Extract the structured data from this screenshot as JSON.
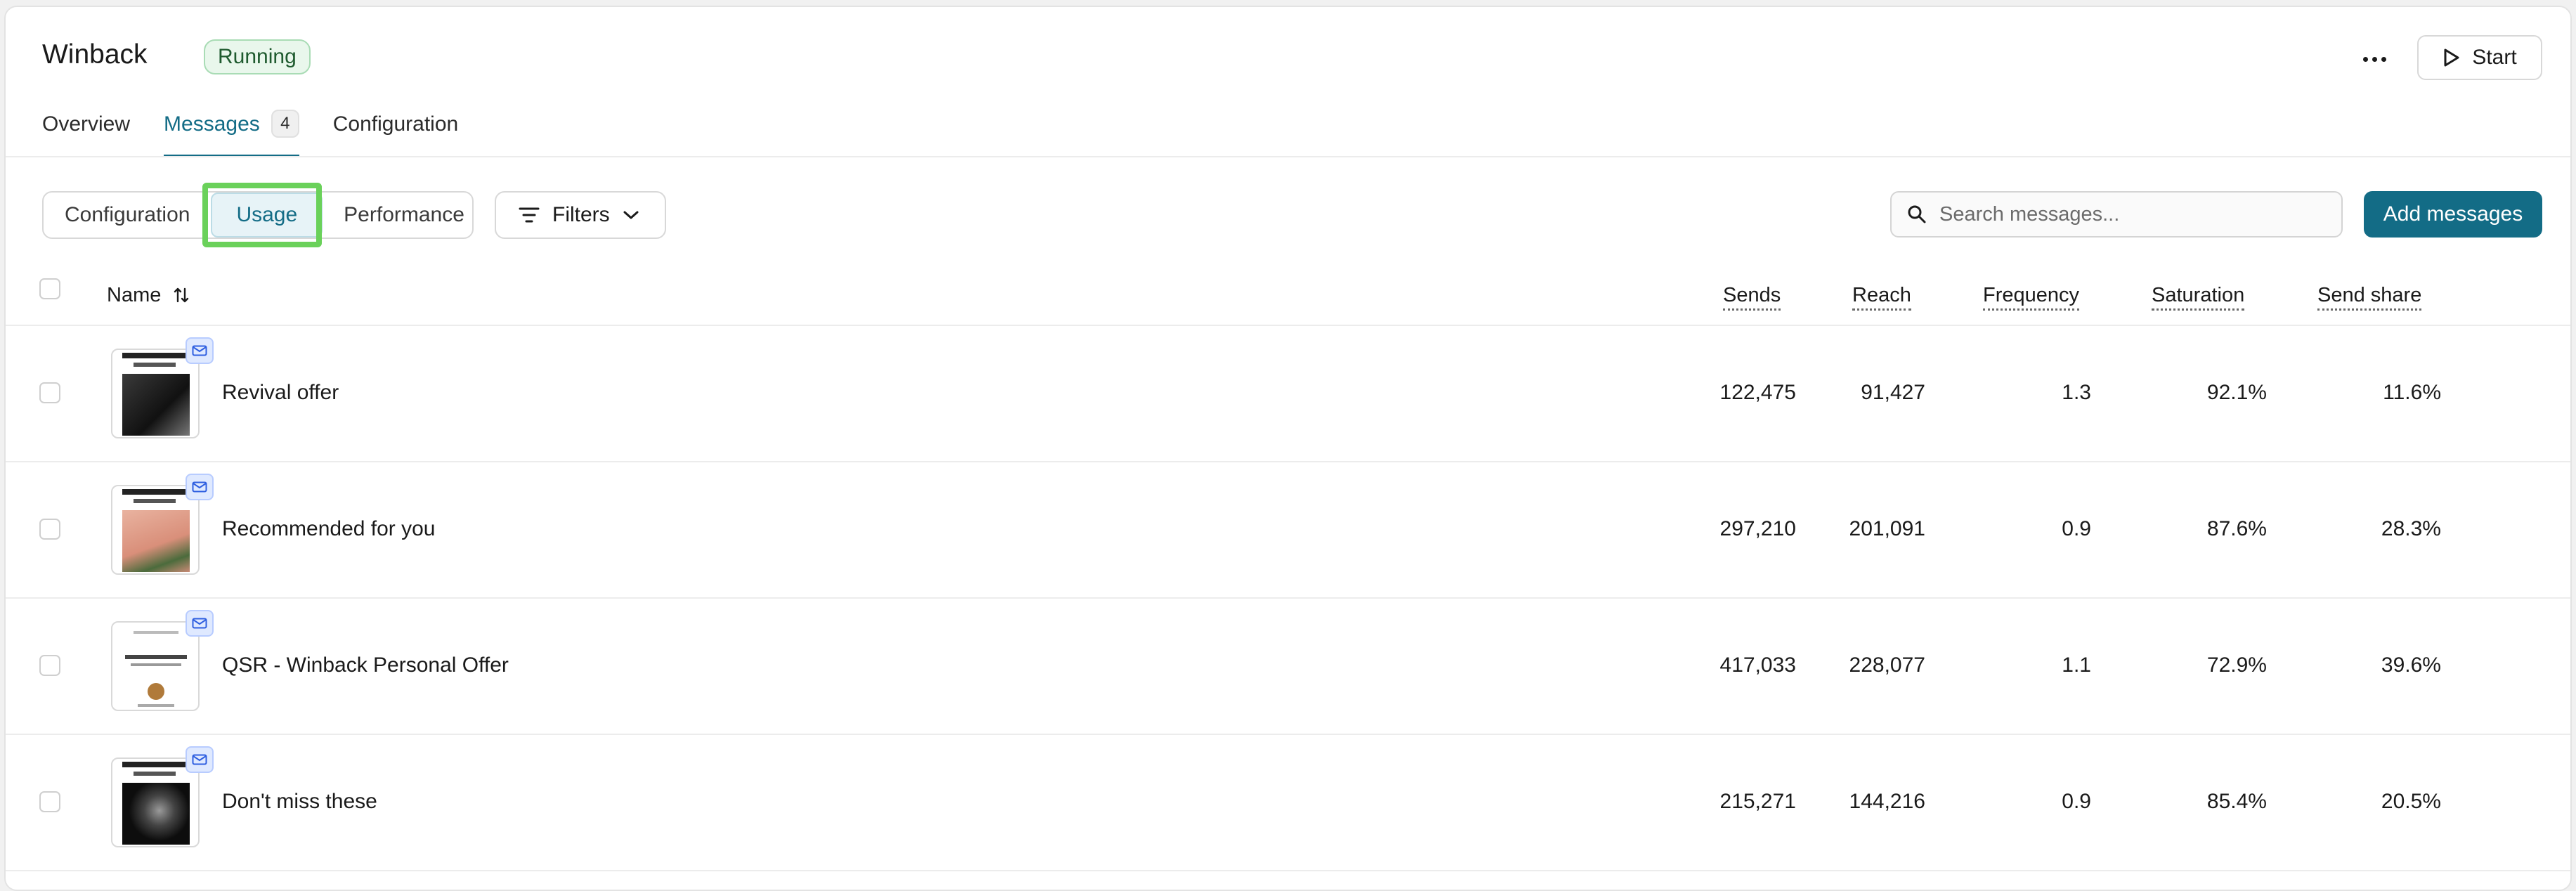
{
  "header": {
    "title": "Winback",
    "status": "Running",
    "start_label": "Start"
  },
  "tabs": [
    {
      "label": "Overview"
    },
    {
      "label": "Messages",
      "count": "4"
    },
    {
      "label": "Configuration"
    }
  ],
  "toolbar": {
    "views": [
      "Configuration",
      "Usage",
      "Performance"
    ],
    "active_view": "Usage",
    "filters_label": "Filters",
    "search_placeholder": "Search messages...",
    "add_label": "Add messages"
  },
  "table": {
    "columns": [
      "Name",
      "Sends",
      "Reach",
      "Frequency",
      "Saturation",
      "Send share"
    ],
    "rows": [
      {
        "name": "Revival offer",
        "sends": "122,475",
        "reach": "91,427",
        "frequency": "1.3",
        "saturation": "92.1%",
        "send_share": "11.6%"
      },
      {
        "name": "Recommended for you",
        "sends": "297,210",
        "reach": "201,091",
        "frequency": "0.9",
        "saturation": "87.6%",
        "send_share": "28.3%"
      },
      {
        "name": "QSR - Winback Personal Offer",
        "sends": "417,033",
        "reach": "228,077",
        "frequency": "1.1",
        "saturation": "72.9%",
        "send_share": "39.6%"
      },
      {
        "name": "Don't miss these",
        "sends": "215,271",
        "reach": "144,216",
        "frequency": "0.9",
        "saturation": "85.4%",
        "send_share": "20.5%"
      }
    ]
  },
  "colors": {
    "accent": "#136c86",
    "running_badge_bg": "#e9f7ec",
    "highlight": "#6ad15a"
  }
}
